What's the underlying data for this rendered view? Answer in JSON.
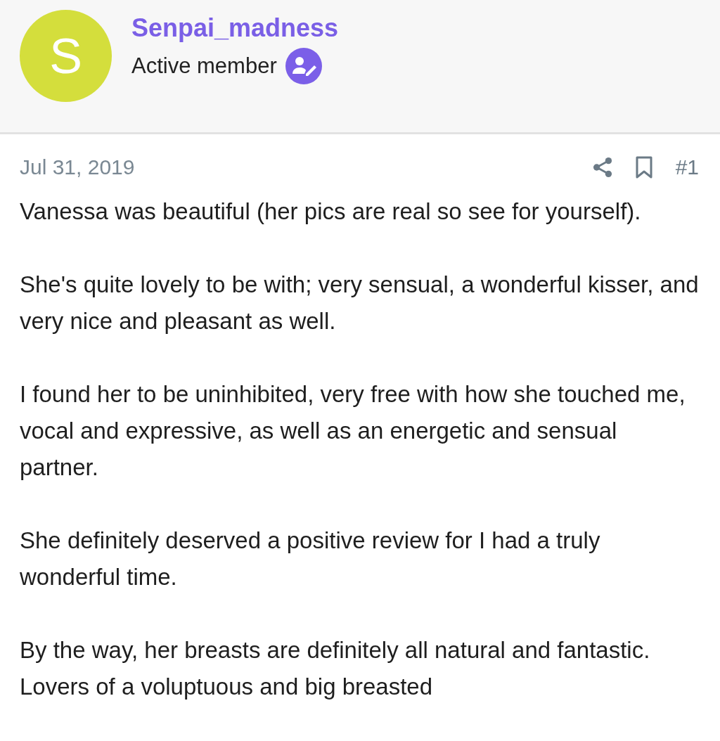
{
  "author": {
    "avatar_letter": "S",
    "name": "Senpai_madness",
    "title": "Active member"
  },
  "post": {
    "date": "Jul 31, 2019",
    "number": "#1",
    "paragraphs": [
      "Vanessa was beautiful (her pics are real so see for yourself).",
      "She's quite lovely to be with; very sensual, a wonderful kisser, and very nice and pleasant as well.",
      "I found her to be uninhibited, very free with how she touched me, vocal and expressive, as well as an energetic and sensual partner.",
      "She definitely deserved a positive review for I had a truly wonderful time.",
      "By the way, her breasts are definitely all natural and fantastic. Lovers of a voluptuous and big breasted"
    ]
  }
}
